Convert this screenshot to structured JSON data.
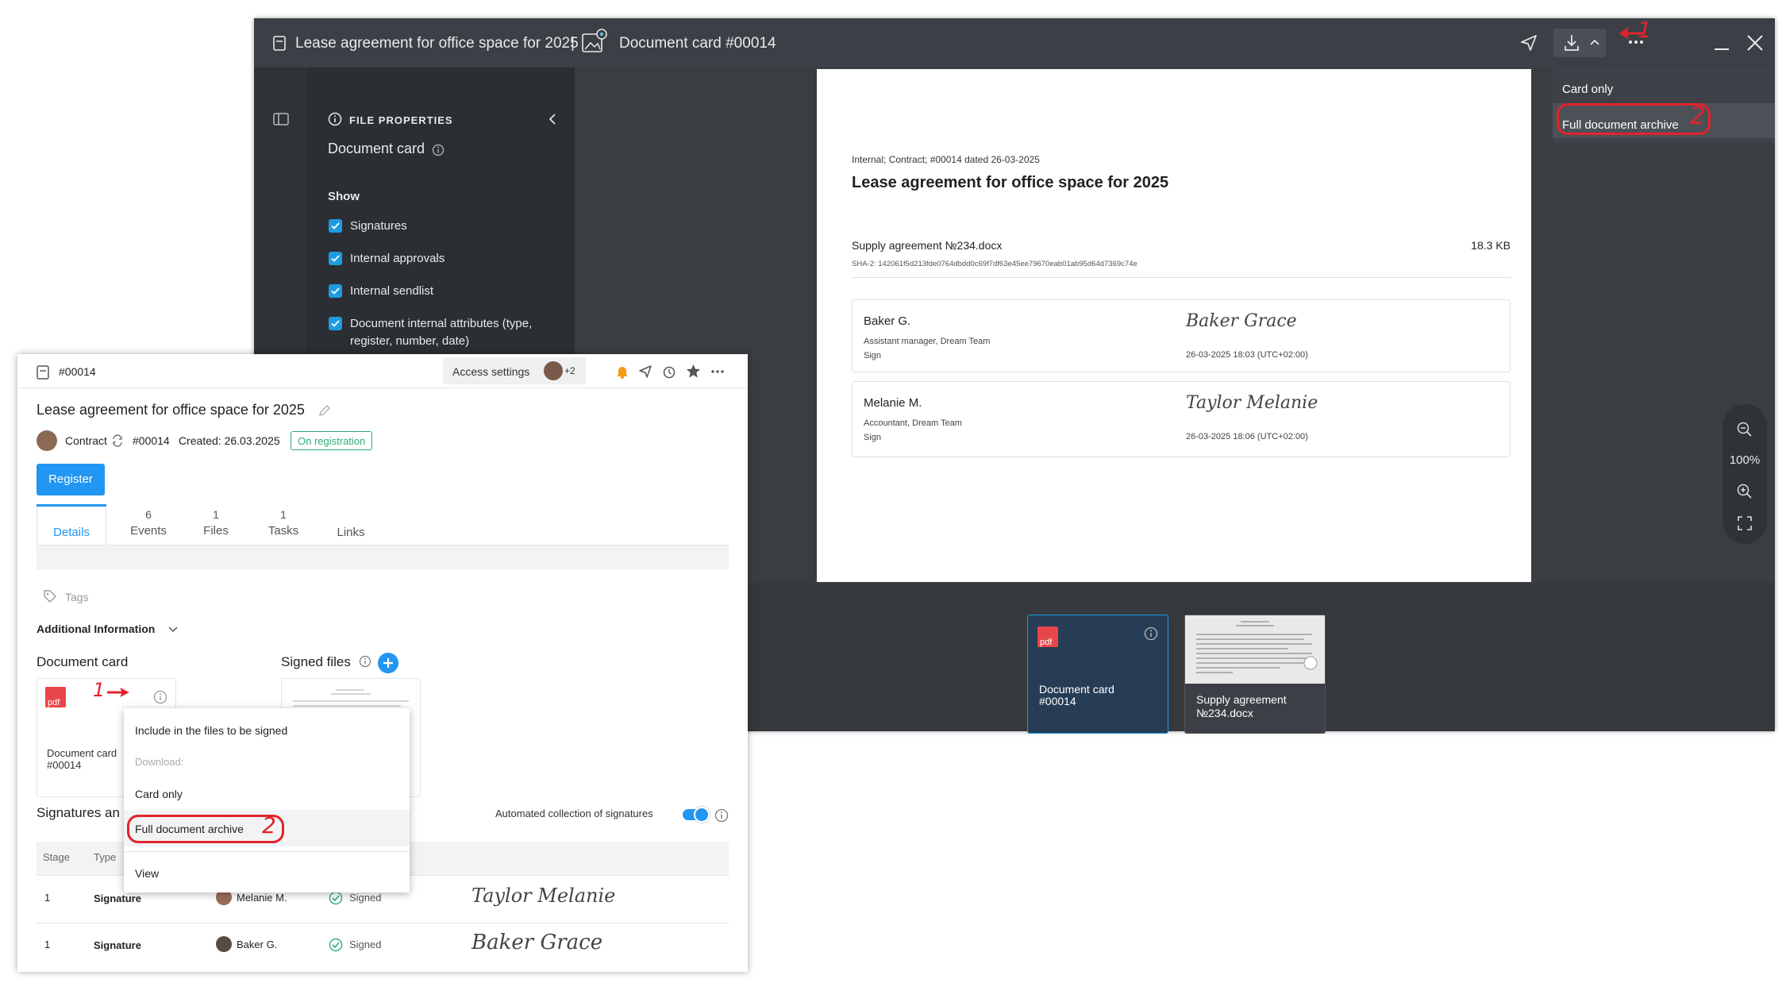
{
  "viewer": {
    "title": "Lease agreement for office space for 2025",
    "separator": "|",
    "card_title": "Document card #00014",
    "props_header": "FILE PROPERTIES",
    "props_title": "Document card",
    "show_label": "Show",
    "checkboxes": [
      {
        "label": "Signatures"
      },
      {
        "label": "Internal approvals"
      },
      {
        "label": "Internal sendlist"
      },
      {
        "label": "Document internal attributes (type, register, number, date)"
      }
    ],
    "download_menu": {
      "card_only": "Card only",
      "full_archive": "Full document archive"
    },
    "annotation_1": "1",
    "annotation_2": "2",
    "page": {
      "meta": "Internal; Contract; #00014 dated 26-03-2025",
      "title": "Lease agreement for office space for 2025",
      "file_name": "Supply agreement №234.docx",
      "file_size": "18.3 KB",
      "hash": "SHA-2: 142061f5d213fde0764dbdd0c69f7df63e45ee79670eab01ab95d64d7369c74e",
      "signers": [
        {
          "name": "Baker G.",
          "role": "Assistant manager, Dream Team",
          "action": "Sign",
          "signature": "Baker Grace",
          "date": "26-03-2025 18:03 (UTC+02:00)"
        },
        {
          "name": "Melanie M.",
          "role": "Accountant, Dream Team",
          "action": "Sign",
          "signature": "Taylor Melanie",
          "date": "26-03-2025 18:06 (UTC+02:00)"
        }
      ]
    },
    "zoom": "100%",
    "thumbnails": [
      {
        "label1": "Document card",
        "label2": "#00014",
        "badge": "pdf"
      },
      {
        "label1": "Supply agreement",
        "label2": "№234.docx"
      }
    ]
  },
  "card": {
    "number": "#00014",
    "access_settings": "Access settings",
    "avatar_count": "+2",
    "title": "Lease agreement for office space for 2025",
    "type": "Contract",
    "doc_number": "#00014",
    "created": "Created: 26.03.2025",
    "status": "On registration",
    "register_button": "Register",
    "tabs": [
      {
        "label": "Details",
        "count": ""
      },
      {
        "label": "Events",
        "count": "6"
      },
      {
        "label": "Files",
        "count": "1"
      },
      {
        "label": "Tasks",
        "count": "1"
      },
      {
        "label": "Links",
        "count": ""
      }
    ],
    "tags": "Tags",
    "additional_info": "Additional Information",
    "document_card": "Document card",
    "signed_files": "Signed files",
    "doc_thumb_label1": "Document card",
    "doc_thumb_label2": "#00014",
    "pdf_badge": "pdf",
    "signatures_heading": "Signatures an",
    "automated_collection": "Automated collection of signatures",
    "context_menu": {
      "include": "Include in the files to be signed",
      "download": "Download:",
      "card_only": "Card only",
      "full_archive": "Full document archive",
      "view": "View"
    },
    "table_headers": {
      "stage": "Stage",
      "type": "Type"
    },
    "rows": [
      {
        "stage": "1",
        "type": "Signature",
        "person": "Melanie M.",
        "status": "Signed",
        "signature": "Taylor Melanie"
      },
      {
        "stage": "1",
        "type": "Signature",
        "person": "Baker G.",
        "status": "Signed",
        "signature": "Baker Grace"
      }
    ]
  }
}
